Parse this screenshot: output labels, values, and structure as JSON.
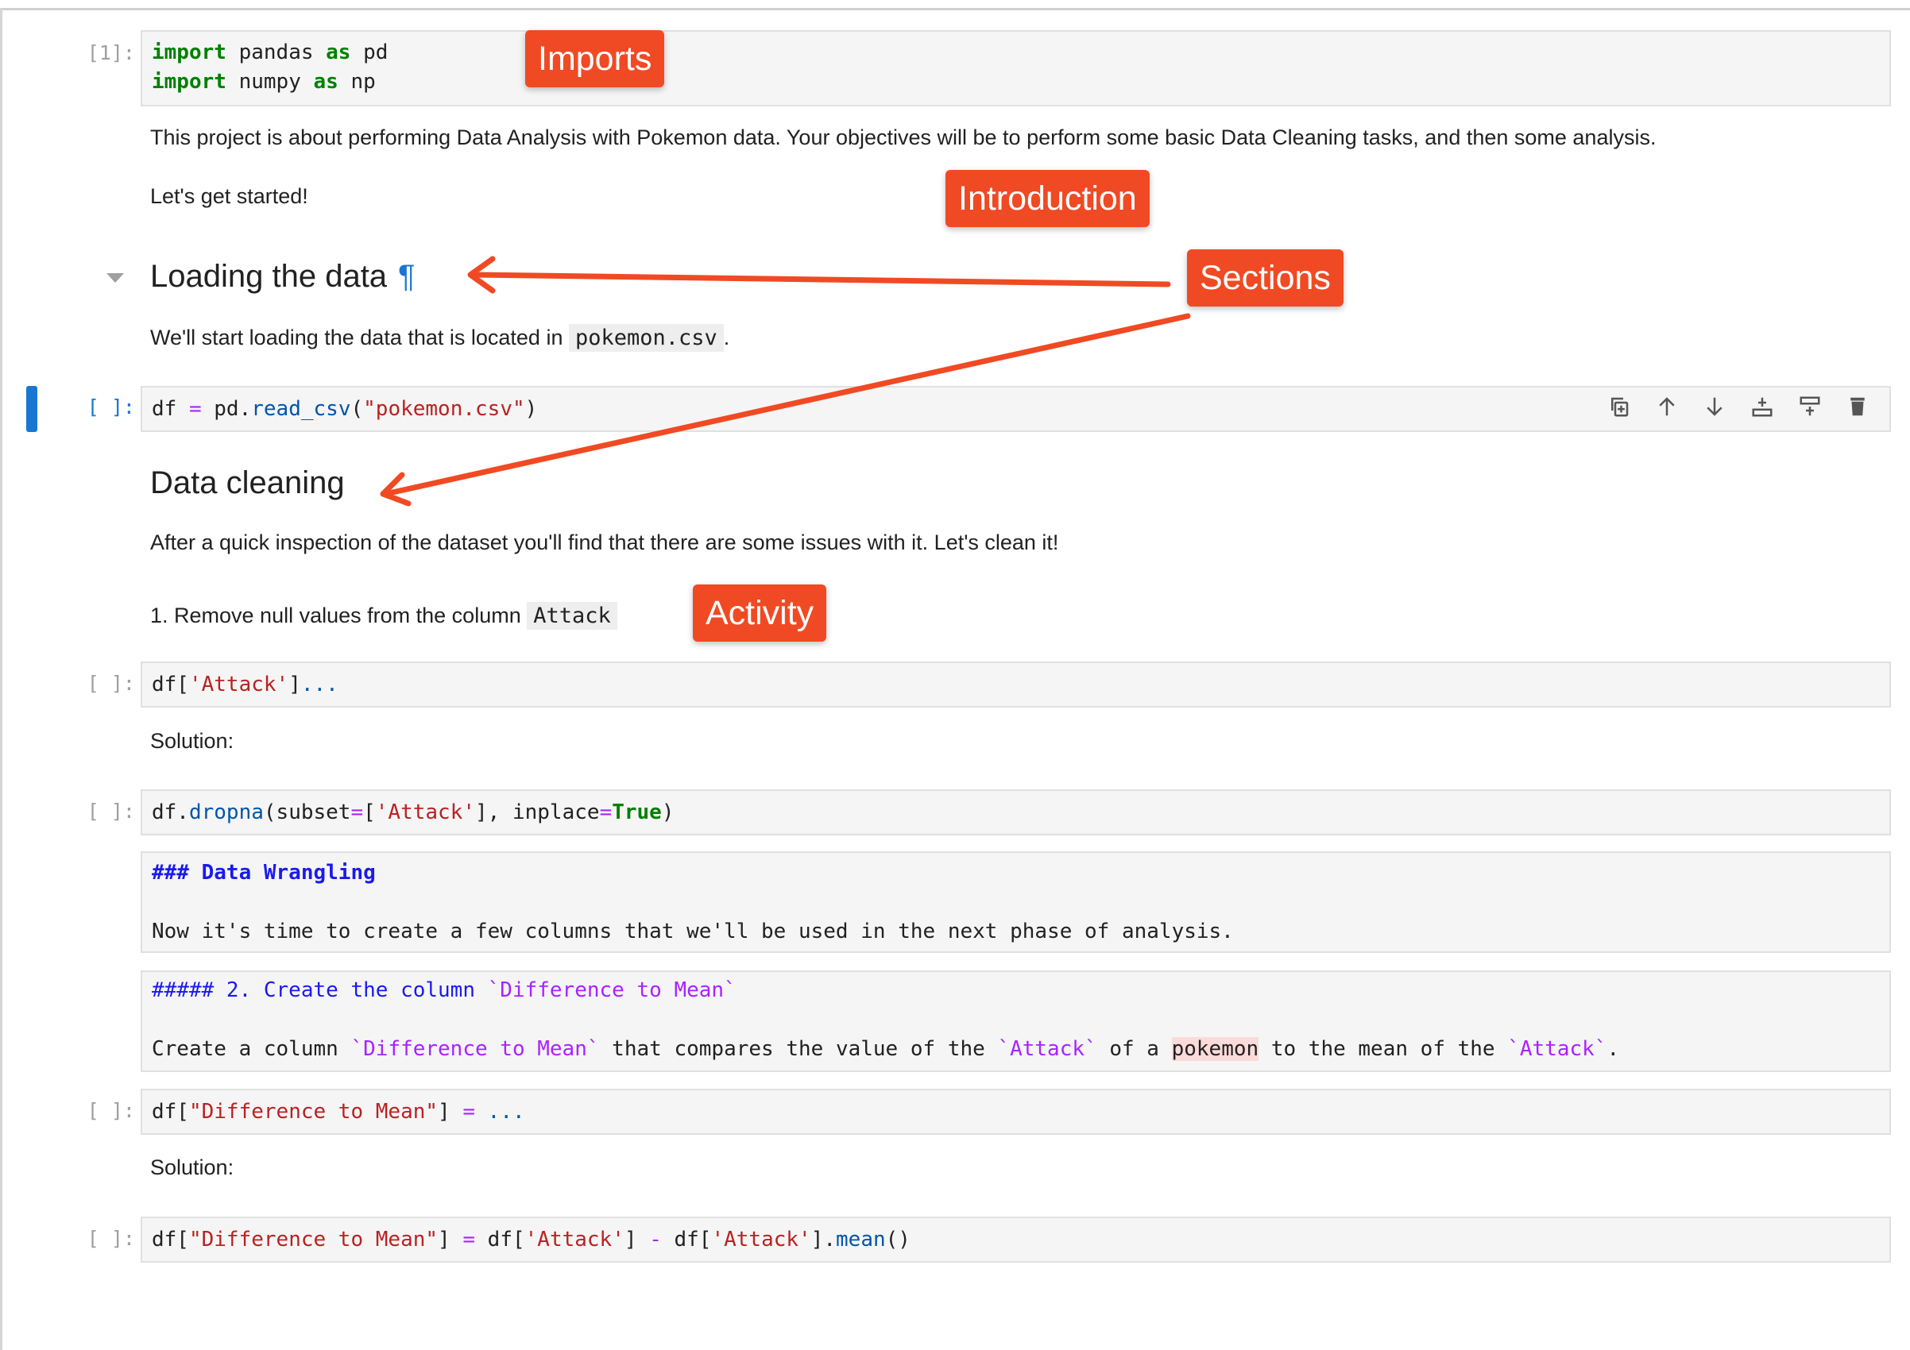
{
  "prompts": {
    "imports": "[1]:",
    "empty": "[ ]:"
  },
  "cells": {
    "imports_line1_kw": "import",
    "imports_line1_mod": " pandas ",
    "imports_line1_as": "as",
    "imports_line1_alias": " pd",
    "imports_line2_kw": "import",
    "imports_line2_mod": " numpy ",
    "imports_line2_as": "as",
    "imports_line2_alias": " np",
    "intro_text": "This project is about performing Data Analysis with Pokemon data. Your objectives will be to perform some basic Data Cleaning tasks, and then some analysis.",
    "started_text": "Let's get started!",
    "section1_title": "Loading the data",
    "pilcrow": "¶",
    "loading_text_pre": "We'll start loading the data that is located in ",
    "loading_code": "pokemon.csv",
    "loading_text_post": ".",
    "read_csv": {
      "a": "df ",
      "eq": "=",
      "b": " pd.",
      "fn": "read_csv",
      "open": "(",
      "str": "\"pokemon.csv\"",
      "close": ")"
    },
    "section2_title": "Data cleaning",
    "cleaning_text": "After a quick inspection of the dataset you'll find that there are some issues with it. Let's clean it!",
    "activity1_pre": "1. Remove null values from the column ",
    "activity1_code": "Attack",
    "attack_cell": {
      "a": "df[",
      "str": "'Attack'",
      "b": "]",
      "ell": "..."
    },
    "solution_label": "Solution:",
    "dropna_cell": {
      "a": "df.",
      "fn": "dropna",
      "b": "(subset",
      "eq": "=",
      "c": "[",
      "str": "'Attack'",
      "d": "], inplace",
      "eq2": "=",
      "kw": "True",
      "e": ")"
    },
    "wrangling_heading": "### Data Wrangling",
    "wrangling_text": "Now it's time to create a few columns that we'll be used in the next phase of analysis.",
    "h5_prefix": "##### 2. Create the column ",
    "h5_code": "`Difference to Mean`",
    "create_pre": "Create a column ",
    "create_code1": "`Difference to Mean`",
    "create_mid1": " that compares the value of the ",
    "create_code2": "`Attack`",
    "create_mid2": " of a ",
    "create_hl": "pokemon",
    "create_mid3": " to the mean of the ",
    "create_code3": "`Attack`",
    "create_end": ".",
    "diff_cell": {
      "a": "df[",
      "str": "\"Difference to Mean\"",
      "b": "] ",
      "eq": "=",
      "ell": " ..."
    },
    "diff_solution": {
      "a": "df[",
      "str": "\"Difference to Mean\"",
      "b": "] ",
      "eq": "=",
      "c": " df[",
      "str2": "'Attack'",
      "d": "] ",
      "minus": "-",
      "e": " df[",
      "str3": "'Attack'",
      "f": "].",
      "fn": "mean",
      "g": "()"
    }
  },
  "annotations": {
    "imports": "Imports",
    "introduction": "Introduction",
    "sections": "Sections",
    "activity": "Activity"
  },
  "toolbar": {
    "icons": [
      "copy-icon",
      "move-up-icon",
      "move-down-icon",
      "insert-above-icon",
      "insert-below-icon",
      "delete-icon"
    ]
  },
  "colors": {
    "annotation": "#f04a24",
    "active_cell": "#1976d2",
    "keyword": "#008000",
    "string": "#ba2121"
  }
}
